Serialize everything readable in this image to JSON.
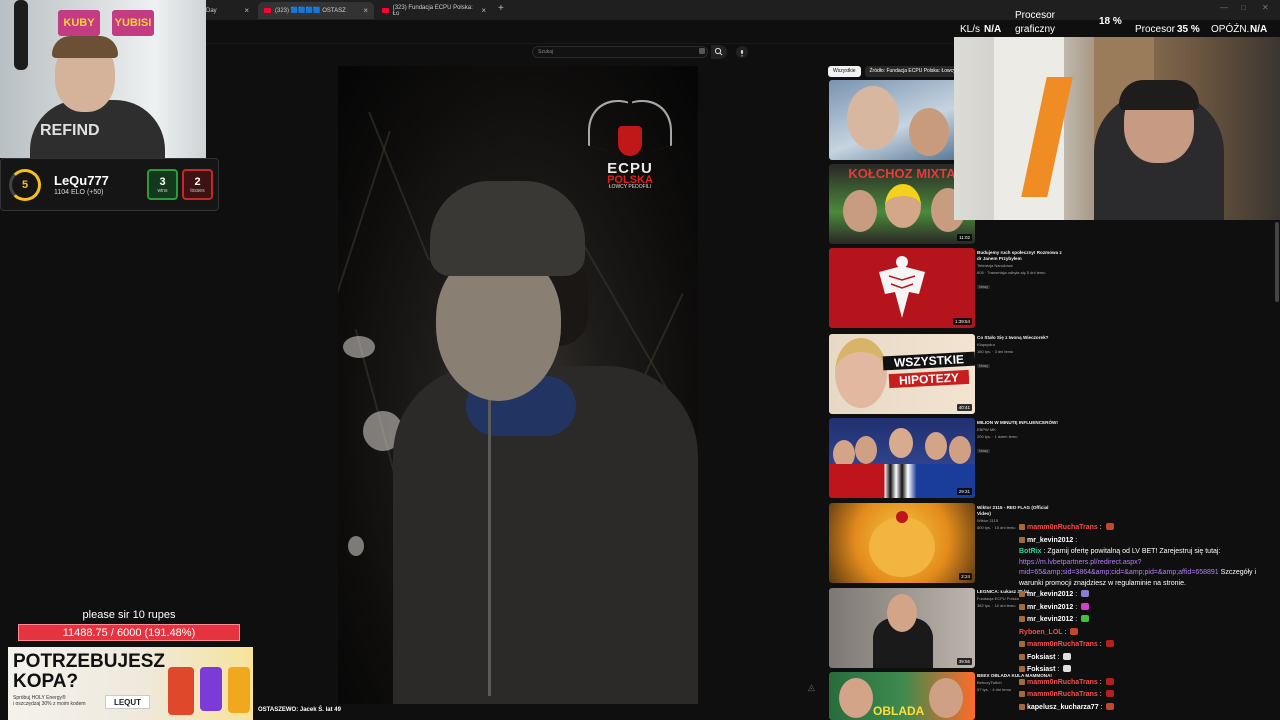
{
  "browser": {
    "tabs": [
      {
        "label": "Day"
      },
      {
        "label": "(323) 🟦🟦🟦🟦 OSTASZ"
      },
      {
        "label": "(323) Fundacja ECPU Polska: Ło"
      }
    ],
    "new_tab": "+",
    "tab_close": "×"
  },
  "youtube": {
    "search_placeholder": "Szukaj",
    "video_title": "OSTASZEWO: Jacek Ś. lat 49",
    "video_logo": {
      "title": "ECPU",
      "sub1": "POLSKA",
      "sub2": "ŁOWCY PEDOFILI"
    },
    "chips": [
      "Wszystkie",
      "Źródło: Fundacja ECPU Polska: Łowcy Pedo"
    ],
    "recommendations": [
      {
        "title": "",
        "channel": "",
        "stats": "",
        "duration": "",
        "colors": [
          "#6f8aa8",
          "#8ab0c8"
        ]
      },
      {
        "title": "",
        "channel": "",
        "stats": "",
        "duration": "11:02",
        "colors": [
          "#2f2a28",
          "#e23030"
        ]
      },
      {
        "title": "Budujemy ruch społeczny! Rozmowa z dr Janem Przybyłem",
        "channel": "Telewizja Narodowa",
        "stats": "605 · Transmisja odbyła się 5 dni temu",
        "badge": "Nowy",
        "duration": "1:39:54",
        "colors": [
          "#b0141d",
          "#d8232f"
        ]
      },
      {
        "title": "Co Stało Się z Iwoną Wieczorek?",
        "channel": "Klapsydra",
        "stats": "160 tys. · 3 dni temu",
        "badge": "Nowy",
        "duration": "40:41",
        "colors": [
          "#d9c9b8",
          "#f2d9c0"
        ]
      },
      {
        "title": "MILION W MINUTĘ INFLUENCERÓW!",
        "channel": "EBPW MK",
        "stats": "200 tys. · 1 dzień temu",
        "badge": "Nowy",
        "duration": "29:31",
        "colors": [
          "#2a3b8a",
          "#c12222"
        ]
      },
      {
        "title": "Wiktor 2115 - RED FLAG (Official Video)",
        "channel": "Wiktor 2115",
        "stats": "800 tys. · 15 dni temu",
        "duration": "2:24",
        "colors": [
          "#e38b1c",
          "#f5c842"
        ]
      },
      {
        "title": "LEGNICA: Łukasz 38 lat",
        "channel": "Fundacja ECPU Polska",
        "stats": "382 tys. · 10 dni temu",
        "duration": "39:56",
        "colors": [
          "#7a7672",
          "#b4aea6"
        ]
      },
      {
        "title": "BEEX OBLADA KULA MAMMONA!",
        "channel": "BeboxyTwitch",
        "stats": "57 tys. · 4 dni temu",
        "badge": "Nowy",
        "duration": "",
        "colors": [
          "#2a6b3c",
          "#ff6b2a"
        ]
      }
    ],
    "rec_texts": {
      "kolchoz": "KOŁCHOZ MIXTA",
      "wszystkie": "WSZYSTKIE",
      "hipotezy": "HIPOTEZY",
      "oblada": "OBLADA"
    }
  },
  "streamer_cam": {
    "sign_left": "KUBY",
    "sign_right": "YUBISI",
    "shirt": "REFIND"
  },
  "elo_widget": {
    "level": "5",
    "name": "LeQu777",
    "elo": "1104 ELO (+50)",
    "wins": "3",
    "wins_label": "wins",
    "losses": "2",
    "losses_label": "losses",
    "accent": "#f6c219"
  },
  "donation_goal": {
    "title": "please sir 10 rupes",
    "progress_text": "11488.75 / 6000 (191.48%)",
    "current": 11488.75,
    "target": 6000,
    "percent": 191.48
  },
  "ad": {
    "headline_1": "POTRZEBUJESZ",
    "headline_2": "KOPA?",
    "sub_1": "Spróbuj HOLY Energy®",
    "sub_2": "i oszczędzaj 30% z moim kodem",
    "brand": "LEQUT"
  },
  "osd": {
    "gpu_percent": "18 %",
    "proc_label": "Procesor",
    "gpu_label": "graficzny",
    "kl_label": "KL/s",
    "kl_value": "N/A",
    "proc2_label": "Procesor",
    "proc2_value": "35 %",
    "latency_label": "OPÓŹN.",
    "latency_value": "N/A"
  },
  "chat": [
    {
      "user": "mamm0nRuchaTrans",
      "text": "",
      "color": "#ff4b4b"
    },
    {
      "user": "mr_kevin2012",
      "text": "",
      "color": "#ffffff"
    },
    {
      "user": "BotRix",
      "text": "Zgarnij ofertę powitalną od LV BET! Zarejestruj się tutaj: ",
      "link": "https://m.lvbetpartners.pl/redirect.aspx?mid=65&amp;sid=3864&amp;cid=&amp;pid=&amp;affid=658891",
      "after": " Szczegóły i warunki promocji znajdziesz w regulaminie na stronie.",
      "color": "#30d4a4"
    },
    {
      "user": "mr_kevin2012",
      "text": "",
      "color": "#ffffff"
    },
    {
      "user": "mr_kevin2012",
      "text": "",
      "color": "#ffffff"
    },
    {
      "user": "mr_kevin2012",
      "text": "",
      "color": "#ffffff"
    },
    {
      "user": "Ryboen_LOL",
      "text": "",
      "color": "#ff4b4b"
    },
    {
      "user": "mamm0nRuchaTrans",
      "text": "",
      "color": "#ff4b4b"
    },
    {
      "user": "Foksiast",
      "text": "",
      "color": "#ffffff"
    },
    {
      "user": "Foksiast",
      "text": "",
      "color": "#ffffff"
    },
    {
      "user": "mamm0nRuchaTrans",
      "text": "",
      "color": "#ff4b4b"
    },
    {
      "user": "mamm0nRuchaTrans",
      "text": "",
      "color": "#ff4b4b"
    },
    {
      "user": "kapelusz_kucharza77",
      "text": "",
      "color": "#ffffff"
    }
  ]
}
